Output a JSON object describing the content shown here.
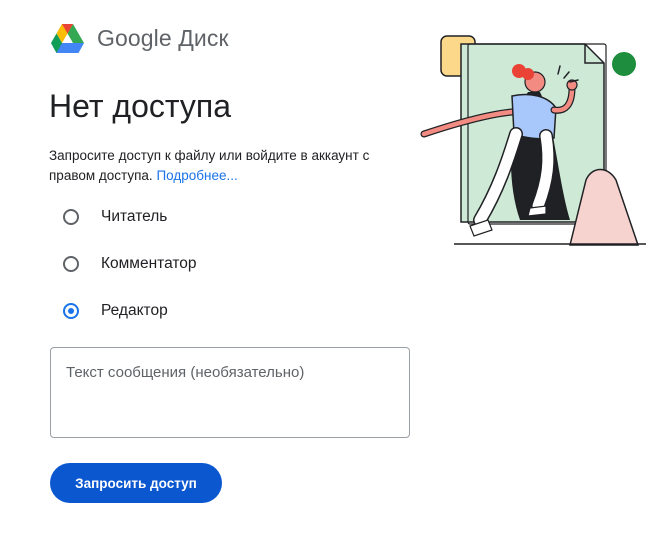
{
  "header": {
    "logo_icon": "google-drive-logo-icon",
    "product_name": "Google Диск"
  },
  "main": {
    "title": "Нет доступа",
    "description": "Запросите доступ к файлу или войдите в аккаунт с правом доступа.",
    "learn_more": "Подробнее...",
    "roles": [
      {
        "label": "Читатель",
        "checked": false
      },
      {
        "label": "Комментатор",
        "checked": false
      },
      {
        "label": "Редактор",
        "checked": true
      }
    ],
    "message_placeholder": "Текст сообщения (необязательно)",
    "message_value": "",
    "request_button": "Запросить доступ"
  },
  "colors": {
    "accent": "#1a73e8",
    "button": "#0b57d0",
    "text": "#202124",
    "secondary_text": "#5f6368"
  }
}
